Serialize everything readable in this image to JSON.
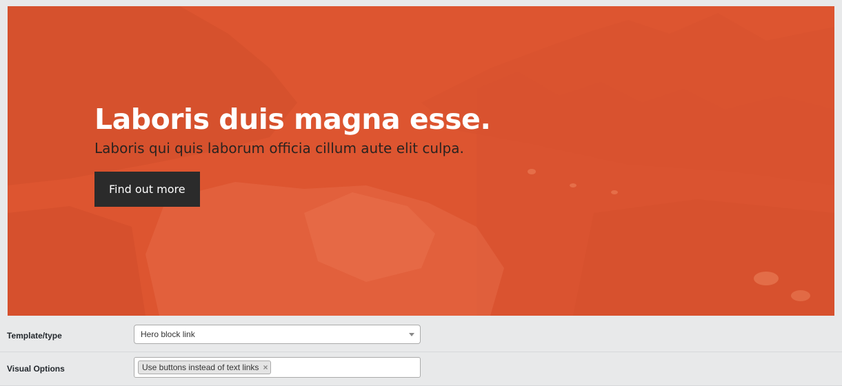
{
  "hero": {
    "title": "Laboris duis magna esse.",
    "subtitle": "Laboris qui quis laborum officia cillum aute elit culpa.",
    "button_label": "Find out more",
    "overlay_color": "#dd5530"
  },
  "form": {
    "template_type": {
      "label": "Template/type",
      "selected": "Hero block link"
    },
    "visual_options": {
      "label": "Visual Options",
      "tags": [
        {
          "label": "Use buttons instead of text links",
          "remove_icon": "close-icon"
        }
      ],
      "remove_glyph": "×"
    }
  }
}
